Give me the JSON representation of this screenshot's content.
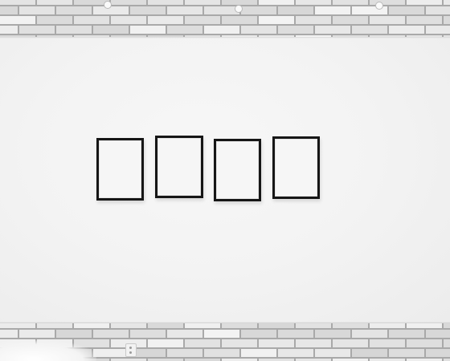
{
  "scene": {
    "colors": {
      "wall": "#f4f4f4",
      "frame_border": "#161616",
      "frame_interior": "#f6f6f6",
      "brick": "#dcdcdc",
      "mortar": "#a9a9a9"
    },
    "frame_count": 4
  }
}
